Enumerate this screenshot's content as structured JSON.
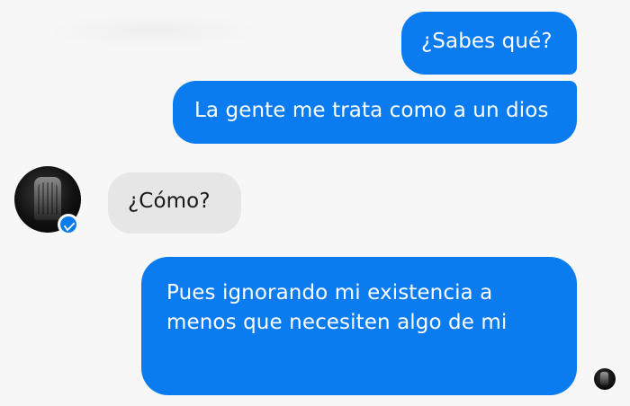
{
  "conversation": {
    "messages": [
      {
        "sender": "me",
        "text": "¿Sabes qué?"
      },
      {
        "sender": "me",
        "text": "La gente me trata como a un dios"
      },
      {
        "sender": "contact",
        "text": "¿Cómo?"
      },
      {
        "sender": "me",
        "text": "Pues ignorando mi existencia a menos que necesiten algo de mi"
      }
    ]
  },
  "contact": {
    "avatar_icon": "profile-avatar-icon",
    "badge_icon": "messenger-badge-icon"
  },
  "read_receipt": {
    "icon": "seen-avatar-icon"
  },
  "colors": {
    "outgoing_bubble": "#0a7cf0",
    "incoming_bubble": "#e6e6e6",
    "background": "#f7f7f7"
  }
}
